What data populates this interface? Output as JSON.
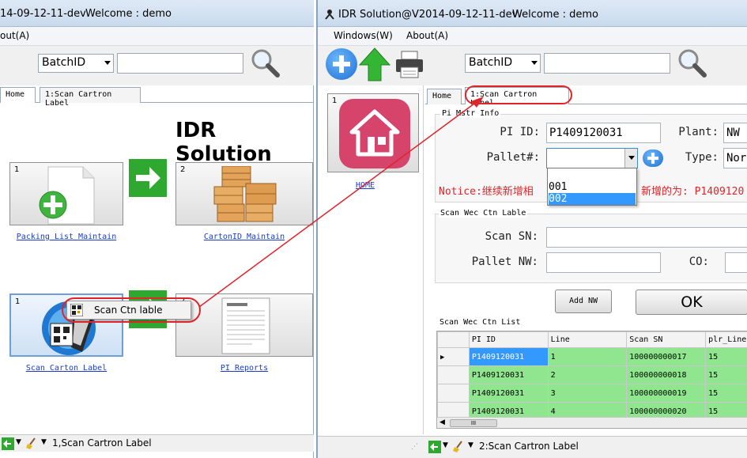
{
  "left_window": {
    "title_partial": "14-09-12-11-dev",
    "welcome": "Welcome : demo",
    "menu_partial": "out(A)",
    "search": {
      "field_label": "BatchID",
      "value": ""
    },
    "tabs": [
      {
        "label": "Home",
        "active": true
      },
      {
        "label": "1:Scan Cartron Label",
        "active": false
      }
    ],
    "brand": "IDR Solution",
    "tiles": [
      {
        "num": "1",
        "label": "Packing List Maintain",
        "icon": "document-add-icon"
      },
      {
        "num": "2",
        "label": "CartonID Maintain",
        "icon": "wooden-crates-icon"
      },
      {
        "num": "1",
        "label": "Scan Carton Label",
        "icon": "barcode-scanner-icon"
      },
      {
        "num": "2",
        "label": "PI Reports",
        "icon": "report-document-icon"
      }
    ],
    "context_menu": {
      "item": "Scan Ctn lable",
      "icon": "qr-code-icon"
    },
    "status": "1,Scan Cartron Label"
  },
  "right_window": {
    "title": "IDR Solution@V2014-09-12-11-dev",
    "welcome": "Welcome : demo",
    "menu": [
      "Windows(W)",
      "About(A)"
    ],
    "search": {
      "field_label": "BatchID",
      "value": ""
    },
    "home_tile": {
      "num": "1",
      "label": "HOME",
      "icon": "house-icon"
    },
    "tabs": [
      {
        "label": "Home",
        "active": false
      },
      {
        "label": "1:Scan Cartron Label",
        "active": true
      }
    ],
    "pi_group": {
      "title": "Pi Mstr Info",
      "pi_id_label": "PI ID:",
      "pi_id_value": "P1409120031",
      "plant_label": "Plant:",
      "plant_value": "NW",
      "pallet_label": "Pallet#:",
      "pallet_value": "",
      "pallet_options": [
        "001",
        "002"
      ],
      "pallet_selected": "002",
      "type_label": "Type:",
      "type_value": "Norm"
    },
    "notice": {
      "left": "Notice:继续新增相",
      "right": "新增的为: P1409120"
    },
    "scan_group": {
      "title": "Scan Wec Ctn Lable",
      "scan_sn_label": "Scan SN:",
      "scan_sn_value": "",
      "pallet_nw_label": "Pallet NW:",
      "pallet_nw_value": "",
      "co_label": "CO:",
      "co_value": ""
    },
    "buttons": {
      "add_nw": "Add NW",
      "ok": "OK"
    },
    "list": {
      "title": "Scan Wec Ctn List",
      "columns": [
        "PI ID",
        "Line",
        "Scan SN",
        "plr_Line"
      ],
      "rows": [
        [
          "P1409120031",
          "1",
          "100000000017",
          "15"
        ],
        [
          "P1409120031",
          "2",
          "100000000018",
          "15"
        ],
        [
          "P1409120031",
          "3",
          "100000000019",
          "15"
        ],
        [
          "P1409120031",
          "4",
          "100000000020",
          "15"
        ]
      ],
      "scroll_thumb": "III"
    },
    "status": "2:Scan Cartron Label"
  },
  "colors": {
    "notice_red": "#e0242a",
    "row_green": "#8fe68f",
    "selection_blue": "#3399ff",
    "annotation_red": "#e0242a",
    "link_blue": "#1a3ccc"
  }
}
